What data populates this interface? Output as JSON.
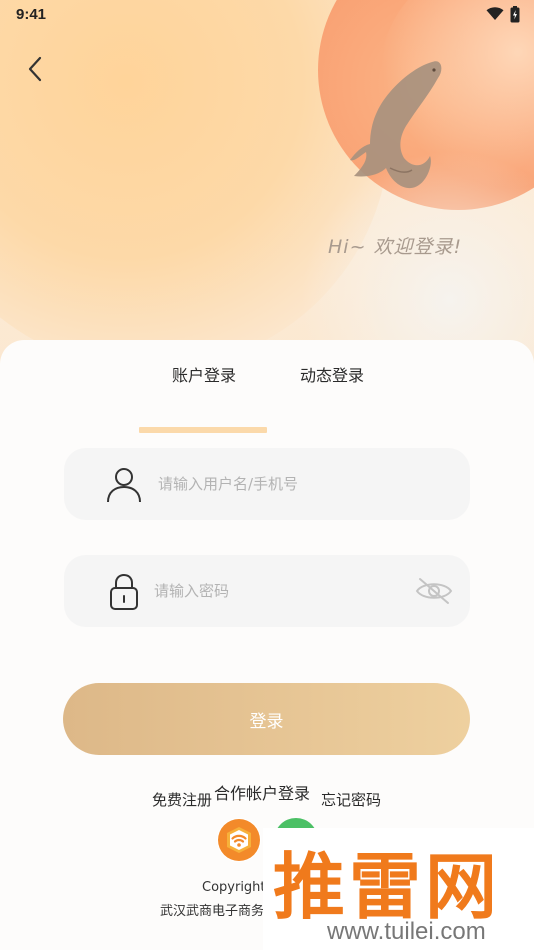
{
  "status_bar": {
    "time": "9:41"
  },
  "header": {
    "greeting": "Hi~ 欢迎登录!"
  },
  "tabs": [
    {
      "label": "账户登录",
      "active": true
    },
    {
      "label": "动态登录",
      "active": false
    }
  ],
  "form": {
    "username": {
      "placeholder": "请输入用户名/手机号",
      "value": ""
    },
    "password": {
      "placeholder": "请输入密码",
      "value": ""
    },
    "login_label": "登录"
  },
  "links": {
    "register": "免费注册",
    "partner": "合作帐户登录",
    "forgot": "忘记密码"
  },
  "footer": {
    "copyright_line1": "Copyright©",
    "copyright_line2": "武汉武商电子商务"
  },
  "watermark": {
    "brand": "推雷网",
    "url": "www.tuilei.com"
  },
  "colors": {
    "accent_start": "#ddb888",
    "accent_end": "#eed09f",
    "tab_indicator": "#fbd9aa",
    "moon": "#f9a274",
    "watermark_orange": "#f07a1c",
    "wechat_green": "#4bc065"
  },
  "icons": {
    "back": "chevron-left-icon",
    "user": "user-icon",
    "lock": "lock-icon",
    "eye": "eye-off-icon",
    "wifi_login": "wifi-icon",
    "wechat": "wechat-icon"
  }
}
